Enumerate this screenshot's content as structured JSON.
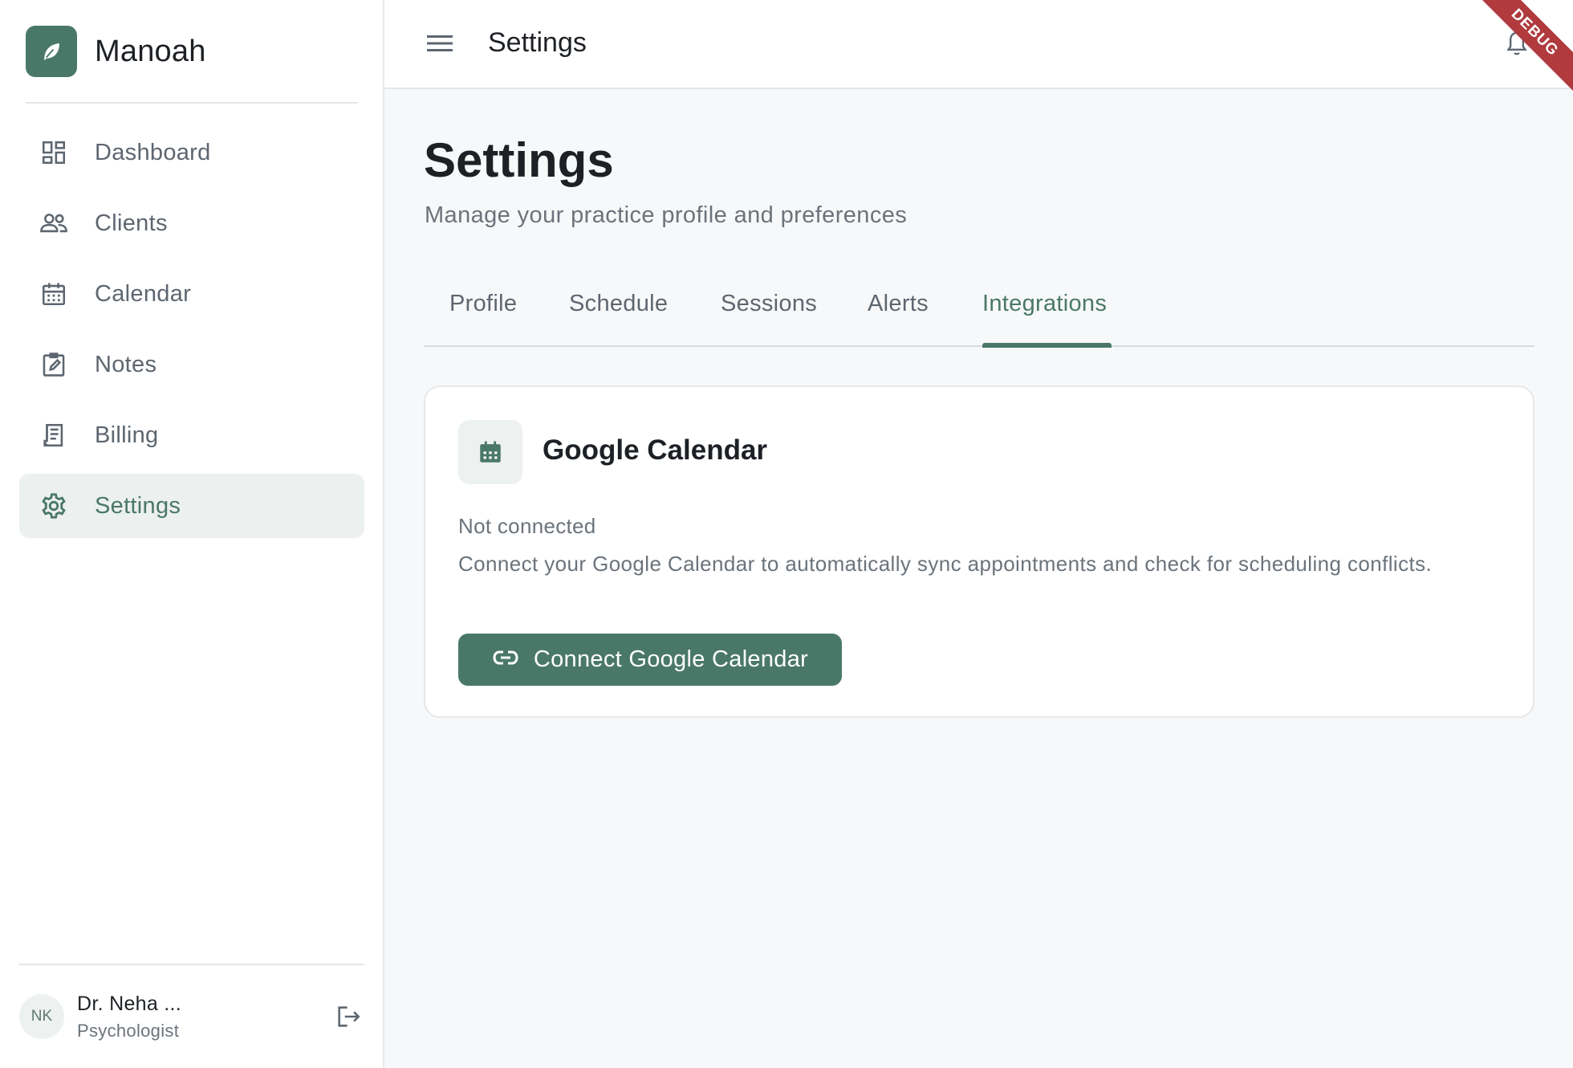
{
  "app": {
    "name": "Manoah",
    "brand_color": "#4a7868"
  },
  "sidebar": {
    "items": [
      {
        "label": "Dashboard",
        "icon": "dashboard-icon"
      },
      {
        "label": "Clients",
        "icon": "people-icon"
      },
      {
        "label": "Calendar",
        "icon": "calendar-icon"
      },
      {
        "label": "Notes",
        "icon": "note-edit-icon"
      },
      {
        "label": "Billing",
        "icon": "receipt-icon"
      },
      {
        "label": "Settings",
        "icon": "gear-icon",
        "active": true
      }
    ],
    "user": {
      "initials": "NK",
      "name": "Dr. Neha ...",
      "role": "Psychologist"
    }
  },
  "topbar": {
    "title": "Settings",
    "debug_label": "DEBUG"
  },
  "page": {
    "title": "Settings",
    "subtitle": "Manage your practice profile and preferences",
    "tabs": [
      {
        "label": "Profile"
      },
      {
        "label": "Schedule"
      },
      {
        "label": "Sessions"
      },
      {
        "label": "Alerts"
      },
      {
        "label": "Integrations",
        "active": true
      }
    ]
  },
  "integration": {
    "title": "Google Calendar",
    "status": "Not connected",
    "description": "Connect your Google Calendar to automatically sync appointments and check for scheduling conflicts.",
    "button_label": "Connect Google Calendar"
  }
}
